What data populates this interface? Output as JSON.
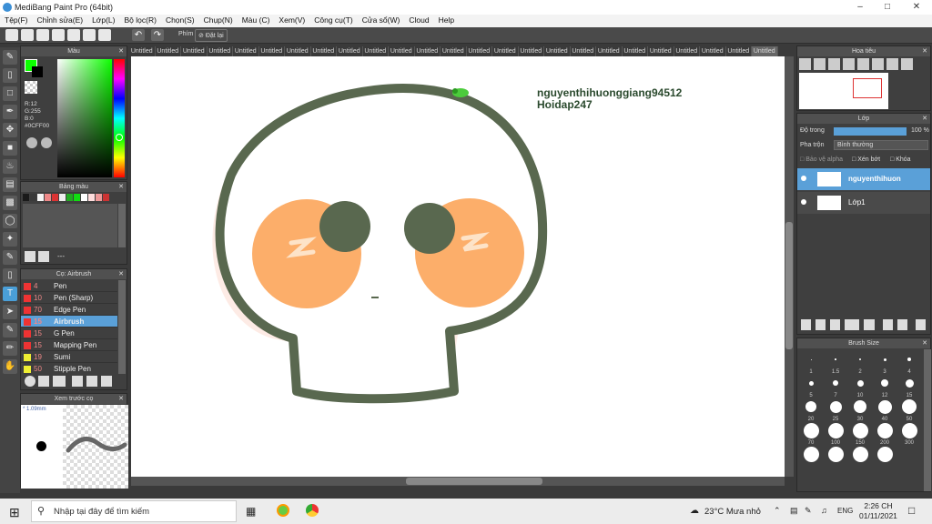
{
  "window": {
    "title": "MediBang Paint Pro (64bit)",
    "minimize_icon": "minimize-icon",
    "maximize_icon": "maximize-icon",
    "close_icon": "close-icon"
  },
  "menu": [
    "Tệp(F)",
    "Chỉnh sửa(E)",
    "Lớp(L)",
    "Bộ lọc(R)",
    "Chọn(S)",
    "Chụp(N)",
    "Màu (C)",
    "Xem(V)",
    "Công cụ(T)",
    "Cửa sổ(W)",
    "Cloud",
    "Help"
  ],
  "toolbar": {
    "phim_label": "Phím",
    "reset_label": "Đặt lại"
  },
  "tabs": [
    "Untitled",
    "Untitled",
    "Untitled",
    "Untitled",
    "Untitled",
    "Untitled",
    "Untitled",
    "Untitled",
    "Untitled",
    "Untitled",
    "Untitled",
    "Untitled",
    "Untitled",
    "Untitled",
    "Untitled",
    "Untitled",
    "Untitled",
    "Untitled",
    "Untitled",
    "Untitled",
    "Untitled",
    "Untitled",
    "Untitled",
    "Untitled",
    "Untitled"
  ],
  "color_panel": {
    "title": "Màu",
    "r": "R:12",
    "g": "G:255",
    "b": "B:0",
    "hex": "#0CFF00",
    "primary": "#0cff00"
  },
  "palette_panel": {
    "title": "Bảng màu",
    "more": "---",
    "swatches": [
      "#1a1a1a",
      "#3a3a3a",
      "#f5f5f5",
      "#e88",
      "#d33",
      "#eee",
      "#2a2",
      "#1d1",
      "#fff",
      "#fdd",
      "#e99",
      "#c33"
    ]
  },
  "brush_panel": {
    "title": "Cọ: Airbrush",
    "brushes": [
      {
        "size": "4",
        "name": "Pen",
        "color": "#e33"
      },
      {
        "size": "10",
        "name": "Pen (Sharp)",
        "color": "#e33"
      },
      {
        "size": "70",
        "name": "Edge Pen",
        "color": "#e33"
      },
      {
        "size": "15",
        "name": "Airbrush",
        "color": "#e33"
      },
      {
        "size": "15",
        "name": "G Pen",
        "color": "#e33"
      },
      {
        "size": "15",
        "name": "Mapping Pen",
        "color": "#e33"
      },
      {
        "size": "19",
        "name": "Sumi",
        "color": "#ee3"
      },
      {
        "size": "50",
        "name": "Stipple Pen",
        "color": "#ee3"
      }
    ]
  },
  "preview_panel": {
    "title": "Xem trước cọ",
    "size": "* 1.09mm"
  },
  "navigator_panel": {
    "title": "Hoa tiêu"
  },
  "layer_panel": {
    "title": "Lớp",
    "opacity_label": "Độ trong",
    "opacity_value": "100 %",
    "blend_label": "Pha trộn",
    "blend_value": "Bình thường",
    "protect_alpha": "Bảo vệ alpha",
    "clipping": "Xén bớt",
    "lock": "Khóa",
    "layers": [
      {
        "name": "nguyenthihuon"
      },
      {
        "name": "Lớp1"
      }
    ]
  },
  "brush_size_panel": {
    "title": "Brush Size",
    "sizes": [
      "1",
      "1.5",
      "2",
      "3",
      "4",
      "5",
      "7",
      "10",
      "12",
      "15",
      "20",
      "25",
      "30",
      "40",
      "50",
      "70",
      "100",
      "150",
      "200",
      "300",
      "",
      "",
      "",
      ""
    ]
  },
  "canvas": {
    "text_line1": "nguyenthihuonggiang94512",
    "text_line2": "Hoidap247"
  },
  "taskbar": {
    "search_placeholder": "Nhập tại đây để tìm kiếm",
    "weather": "23°C  Mưa nhỏ",
    "lang": "ENG",
    "time": "2:26 CH",
    "date": "01/11/2021"
  }
}
